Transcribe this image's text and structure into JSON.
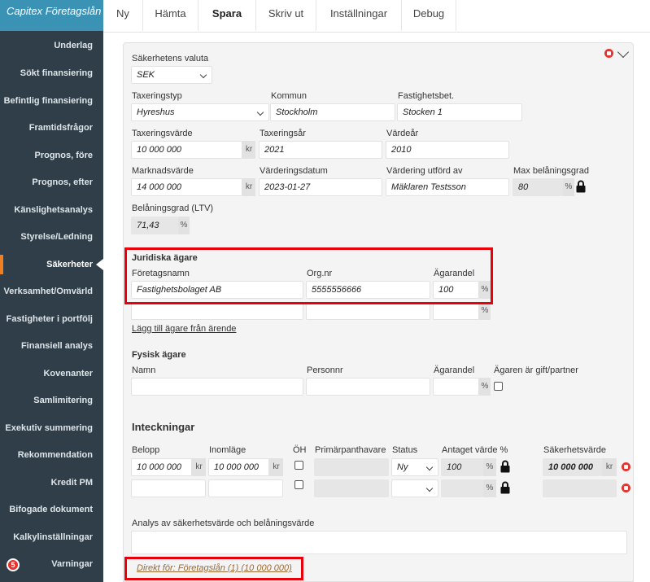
{
  "app_title": "Capitex Företagslån",
  "nav": {
    "items": [
      "Underlag",
      "Sökt finansiering",
      "Befintlig finansiering",
      "Framtidsfrågor",
      "Prognos, före",
      "Prognos, efter",
      "Känslighetsanalys",
      "Styrelse/Ledning",
      "Säkerheter",
      "Verksamhet/Omvärld",
      "Fastigheter i portfölj",
      "Finansiell analys",
      "Kovenanter",
      "Samlimitering",
      "Exekutiv summering",
      "Rekommendation",
      "Kredit PM",
      "Bifogade dokument",
      "Kalkylinställningar",
      "Varningar"
    ],
    "active": "Säkerheter",
    "warnings_count": "5"
  },
  "topmenu": [
    "Ny",
    "Hämta",
    "Spara",
    "Skriv ut",
    "Inställningar",
    "Debug"
  ],
  "form": {
    "currency": {
      "label": "Säkerhetens valuta",
      "value": "SEK"
    },
    "tax_type": {
      "label": "Taxeringstyp",
      "value": "Hyreshus"
    },
    "municipality": {
      "label": "Kommun",
      "value": "Stockholm"
    },
    "property": {
      "label": "Fastighetsbet.",
      "value": "Stocken 1"
    },
    "tax_value": {
      "label": "Taxeringsvärde",
      "value": "10 000 000",
      "unit": "kr"
    },
    "tax_year": {
      "label": "Taxeringsår",
      "value": "2021"
    },
    "value_year": {
      "label": "Värdeår",
      "value": "2010"
    },
    "market_value": {
      "label": "Marknadsvärde",
      "value": "14 000 000",
      "unit": "kr"
    },
    "valuation_date": {
      "label": "Värderingsdatum",
      "value": "2023-01-27"
    },
    "valued_by": {
      "label": "Värdering utförd av",
      "value": "Mäklaren Testsson"
    },
    "max_ltv": {
      "label": "Max belåningsgrad",
      "value": "80",
      "unit": "%"
    },
    "ltv": {
      "label": "Belåningsgrad (LTV)",
      "value": "71,43",
      "unit": "%"
    }
  },
  "legal_owners": {
    "title": "Juridiska ägare",
    "col_company": "Företagsnamn",
    "col_orgnr": "Org.nr",
    "col_share": "Ägarandel",
    "row1": {
      "company": "Fastighetsbolaget AB",
      "orgnr": "5555556666",
      "share": "100",
      "unit": "%"
    },
    "row2": {
      "unit": "%"
    },
    "add_link": "Lägg till ägare från ärende"
  },
  "physical_owners": {
    "title": "Fysisk ägare",
    "col_name": "Namn",
    "col_personnr": "Personnr",
    "col_share": "Ägarandel",
    "col_married": "Ägaren är gift/partner",
    "unit": "%"
  },
  "mortgages": {
    "title": "Inteckningar",
    "col_amount": "Belopp",
    "col_position": "Inomläge",
    "col_oh": "ÖH",
    "col_primary_holder": "Primärpanthavare",
    "col_status": "Status",
    "col_assumed": "Antaget värde %",
    "col_security": "Säkerhetsvärde",
    "row1": {
      "amount": "10 000 000",
      "amount_unit": "kr",
      "position": "10 000 000",
      "position_unit": "kr",
      "status": "Ny",
      "assumed": "100",
      "assumed_unit": "%",
      "security": "10 000 000",
      "security_unit": "kr"
    },
    "row2": {
      "assumed_unit": "%"
    }
  },
  "analysis": {
    "label": "Analys av säkerhetsvärde och belåningsvärde"
  },
  "direct_link": "Direkt för: Företagslån (1) (10 000 000)"
}
